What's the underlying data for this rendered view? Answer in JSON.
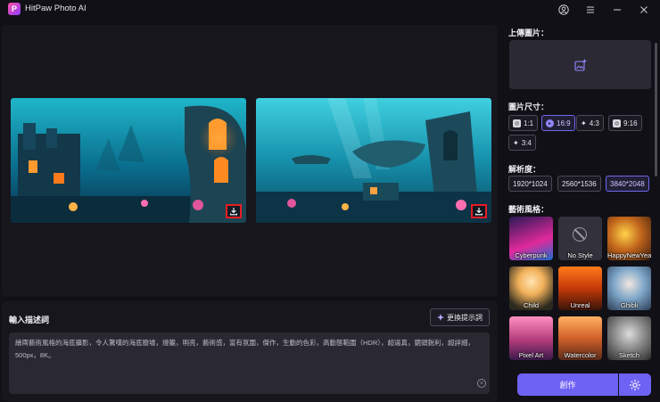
{
  "app": {
    "logo_letter": "P",
    "title": "HitPaw Photo AI"
  },
  "window_controls": {
    "account_icon": "user-circle-icon",
    "menu_icon": "hamburger-icon",
    "minimize_icon": "minimize-icon",
    "close_icon": "close-icon"
  },
  "results": [
    {
      "scene": "underwater ruins with glowing windows",
      "download_icon": "download-icon"
    },
    {
      "scene": "underwater sunken city with floating rocks",
      "download_icon": "download-icon"
    }
  ],
  "prompt": {
    "title": "輸入描述詞",
    "change_label": "更換提示詞",
    "text": "繪兩藝術風格的海底攝影，令人驚嘆的海底廢墟，燈籠，明亮，藝術感，富有氛圍，傑作，生動的色彩，高動態範圍（HDR），超逼真，鏡頭銳利，超詳細，500px，8K。"
  },
  "sidebar": {
    "upload_label": "上傳圖片：",
    "size_label": "圖片尺寸：",
    "sizes": [
      {
        "label": "1:1",
        "icon": "instagram-icon",
        "active": false
      },
      {
        "label": "16:9",
        "icon": "youtube-icon",
        "active": true
      },
      {
        "label": "4:3",
        "icon": "twitter-icon",
        "active": false
      },
      {
        "label": "9:16",
        "icon": "instagram-icon",
        "active": false
      },
      {
        "label": "3:4",
        "icon": "twitter-icon",
        "active": false
      }
    ],
    "resolution_label": "解析度：",
    "resolutions": [
      {
        "label": "1920*1024",
        "active": false
      },
      {
        "label": "2560*1536",
        "active": false
      },
      {
        "label": "3840*2048",
        "active": true
      }
    ],
    "style_label": "藝術風格：",
    "styles": [
      "Cyberpunk",
      "No Style",
      "HappyNewYear",
      "Child",
      "Unreal",
      "Ghibli",
      "Pixel Art",
      "Watercolor",
      "Sketch"
    ]
  },
  "actions": {
    "create_label": "創作",
    "settings_icon": "gear-icon"
  },
  "colors": {
    "accent": "#6e62f5",
    "highlight": "#e81c24",
    "panel": "#17161d"
  }
}
